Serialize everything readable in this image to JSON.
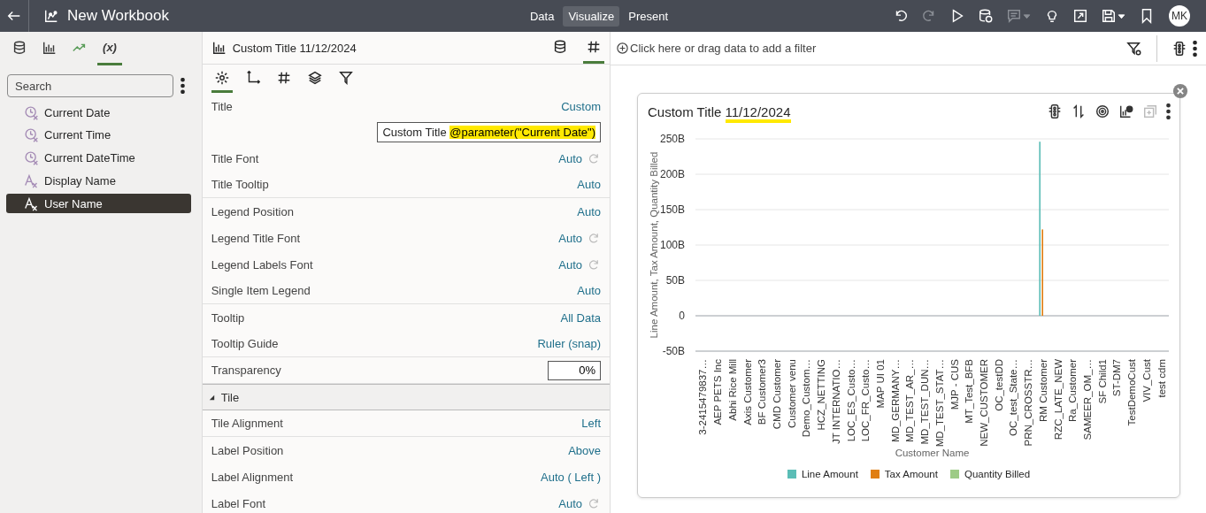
{
  "topbar": {
    "title": "New Workbook",
    "modes": [
      {
        "label": "Data",
        "selected": false
      },
      {
        "label": "Visualize",
        "selected": true
      },
      {
        "label": "Present",
        "selected": false
      }
    ],
    "tools": [
      {
        "disabled": false
      },
      {
        "disabled": true
      },
      {
        "disabled": false
      },
      {
        "disabled": false
      },
      {
        "disabled": true
      },
      {
        "disabled": false
      },
      {
        "disabled": false
      },
      {
        "disabled": false
      },
      {
        "disabled": false
      }
    ],
    "avatar": "MK"
  },
  "left_panel": {
    "tabs": [
      {
        "selected": false
      },
      {
        "selected": false
      },
      {
        "selected": false
      },
      {
        "label": "(x)",
        "selected": true
      }
    ],
    "search": {
      "placeholder": "Search"
    },
    "items": [
      {
        "label": "Current Date",
        "kind": "datetime",
        "selected": false
      },
      {
        "label": "Current Time",
        "kind": "datetime",
        "selected": false
      },
      {
        "label": "Current DateTime",
        "kind": "datetime",
        "selected": false
      },
      {
        "label": "Display Name",
        "kind": "text",
        "selected": false
      },
      {
        "label": "User Name",
        "kind": "text",
        "selected": true
      }
    ]
  },
  "properties": {
    "title": "Custom Title 11/12/2024",
    "header_tabs": [
      {
        "selected": false
      },
      {
        "selected": true
      }
    ],
    "tabs": [
      {
        "selected": true
      },
      {
        "selected": false
      },
      {
        "selected": false
      },
      {
        "selected": false
      },
      {
        "selected": false
      }
    ],
    "rows": [
      {
        "kind": "link",
        "label": "Title",
        "value": "Custom",
        "reset": false,
        "divider": false
      },
      {
        "kind": "expression",
        "text": "Custom Title ",
        "highlight": "@parameter(\"Current Date\")"
      },
      {
        "kind": "link",
        "label": "Title Font",
        "value": "Auto",
        "reset": true,
        "divider": false
      },
      {
        "kind": "link",
        "label": "Title Tooltip",
        "value": "Auto",
        "reset": false,
        "divider": true
      },
      {
        "kind": "link",
        "label": "Legend Position",
        "value": "Auto",
        "reset": false,
        "divider": false
      },
      {
        "kind": "link",
        "label": "Legend Title Font",
        "value": "Auto",
        "reset": true,
        "divider": false
      },
      {
        "kind": "link",
        "label": "Legend Labels Font",
        "value": "Auto",
        "reset": true,
        "divider": false
      },
      {
        "kind": "link",
        "label": "Single Item Legend",
        "value": "Auto",
        "reset": false,
        "divider": true
      },
      {
        "kind": "link",
        "label": "Tooltip",
        "value": "All Data",
        "reset": false,
        "divider": false
      },
      {
        "kind": "link",
        "label": "Tooltip Guide",
        "value": "Ruler (snap)",
        "reset": false,
        "divider": true
      },
      {
        "kind": "input",
        "label": "Transparency",
        "value": "0%"
      },
      {
        "kind": "section",
        "label": "Tile",
        "expanded": true
      },
      {
        "kind": "link",
        "label": "Tile Alignment",
        "value": "Left",
        "reset": false,
        "divider": true
      },
      {
        "kind": "link",
        "label": "Label Position",
        "value": "Above",
        "reset": false,
        "divider": false
      },
      {
        "kind": "link",
        "label": "Label Alignment",
        "value": "Auto ( Left )",
        "reset": false,
        "divider": false
      },
      {
        "kind": "link",
        "label": "Label Font",
        "value": "Auto",
        "reset": true,
        "divider": false
      }
    ]
  },
  "filter_bar": {
    "placeholder": "Click here or drag data to add a filter"
  },
  "chart_card": {
    "title": "Custom Title ",
    "title_highlight": "11/12/2024",
    "tools": [
      {
        "disabled": false
      },
      {
        "disabled": false
      },
      {
        "disabled": false
      },
      {
        "disabled": false
      },
      {
        "disabled": true
      },
      {
        "disabled": false
      }
    ],
    "chart_data": {
      "type": "bar",
      "xlabel": "Customer Name",
      "ylabel": "Line Amount, Tax Amount, Quantity Billed",
      "categories": [
        "3-2415479837…",
        "AEP PETS Inc",
        "Abhi Rice Mill",
        "Axis Customer",
        "BF Customer3",
        "CMD Customer",
        "Customer venu",
        "Demo_Custom…",
        "HCZ_NETTING",
        "JT INTERNATIO…",
        "LOC_ES_Custo…",
        "LOC_FR_Custo…",
        "MAP UI 01",
        "MD_GERMANY…",
        "MD_TEST_AR_…",
        "MD_TEST_DUN…",
        "MD_TEST_STAT…",
        "MJP - CUS",
        "MT_Test_BFB",
        "NEW_CUSTOMER",
        "OC_testDD",
        "OC_test_State…",
        "PRN_CROSSTR…",
        "RM Customer",
        "RZC_LATE_NEW",
        "Ra_Customer",
        "SAMEER_OM_…",
        "SF Child1",
        "ST-DM7",
        "TestDemoCust",
        "VIV_Cust",
        "test cdm"
      ],
      "series": [
        {
          "name": "Line Amount",
          "color": "#5bbdb6",
          "values": [
            0,
            0,
            0,
            0,
            0,
            0,
            0,
            0,
            0,
            0,
            0,
            0,
            0,
            0,
            0,
            0,
            0,
            0,
            0,
            0,
            0,
            0,
            0,
            246,
            0,
            0,
            0,
            0,
            0,
            0,
            0,
            0
          ]
        },
        {
          "name": "Tax Amount",
          "color": "#e07e12",
          "values": [
            0,
            0,
            0,
            0,
            0,
            0,
            0,
            0,
            0,
            0,
            0,
            0,
            0,
            0,
            0,
            0,
            0,
            0,
            0,
            0,
            0,
            0,
            0,
            122,
            0,
            0,
            0,
            0,
            0,
            0,
            0,
            0
          ]
        },
        {
          "name": "Quantity Billed",
          "color": "#9dcb86",
          "values": [
            0,
            0,
            0,
            0,
            0,
            0,
            0,
            0,
            0,
            0,
            0,
            0,
            0,
            0,
            0,
            0,
            0,
            0,
            0,
            0,
            0,
            0,
            0,
            0,
            0,
            0,
            0,
            0,
            0,
            0,
            0,
            0
          ]
        }
      ],
      "ylim": [
        -50,
        250
      ],
      "grid": true,
      "yticks": [
        {
          "value": -50,
          "label": "-50B"
        },
        {
          "value": 0,
          "label": "0"
        },
        {
          "value": 50,
          "label": "50B"
        },
        {
          "value": 100,
          "label": "100B"
        },
        {
          "value": 150,
          "label": "150B"
        },
        {
          "value": 200,
          "label": "200B"
        },
        {
          "value": 250,
          "label": "250B"
        }
      ]
    }
  }
}
